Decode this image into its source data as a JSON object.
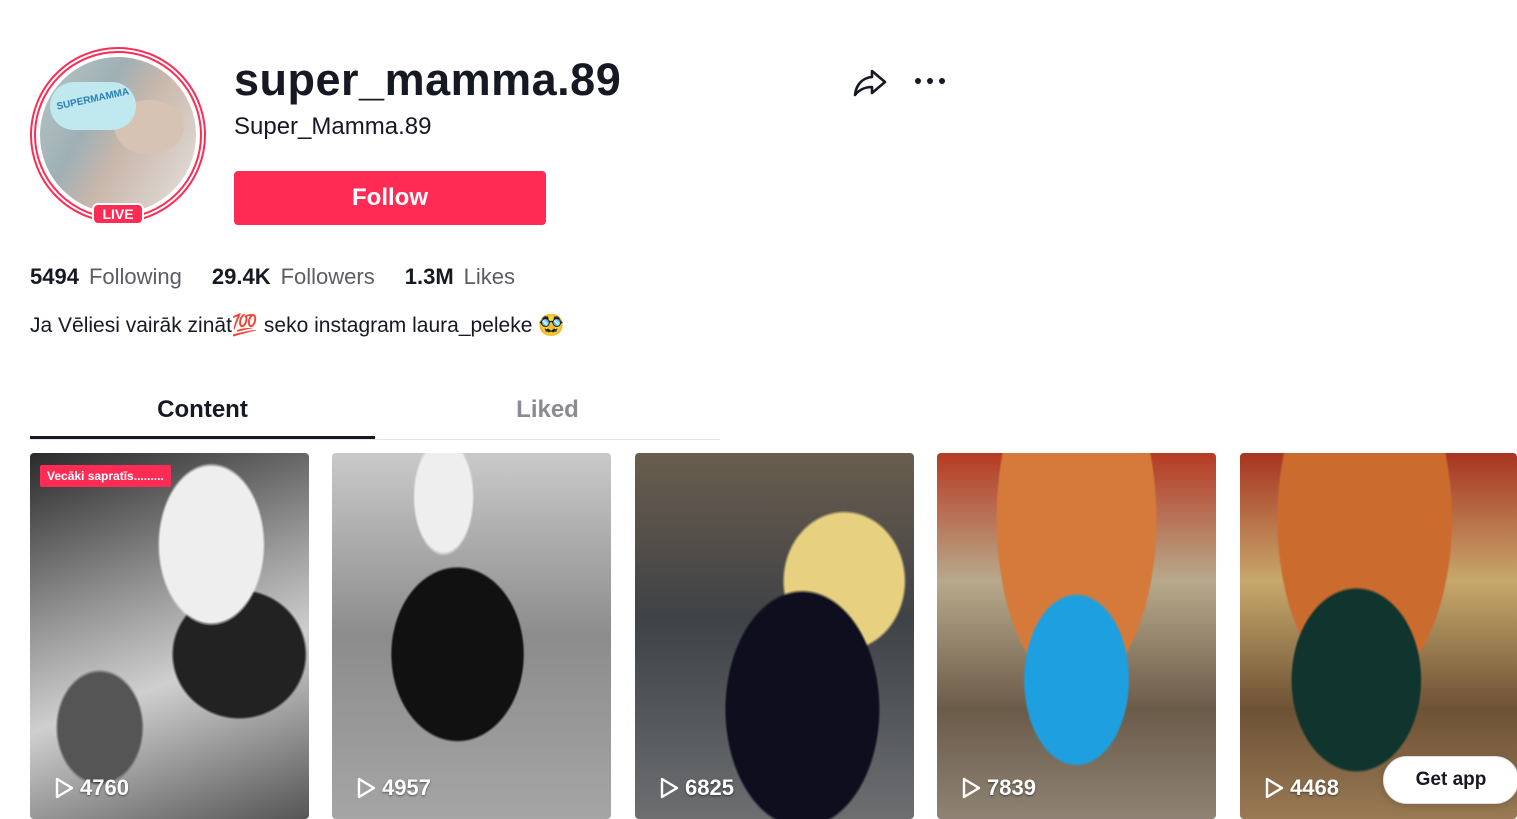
{
  "profile": {
    "username": "super_mamma.89",
    "nickname": "Super_Mamma.89",
    "avatar_text": "SUPERMAMMA",
    "live_badge": "LIVE",
    "follow_label": "Follow",
    "bio": "Ja Vēliesi vairāk zināt💯 seko instagram laura_peleke 🥸"
  },
  "stats": {
    "following": {
      "value": "5494",
      "label": "Following"
    },
    "followers": {
      "value": "29.4K",
      "label": "Followers"
    },
    "likes": {
      "value": "1.3M",
      "label": "Likes"
    }
  },
  "tabs": [
    {
      "label": "Content",
      "active": true
    },
    {
      "label": "Liked",
      "active": false
    }
  ],
  "videos": [
    {
      "views": "4760",
      "overlay_text": "Vecāki sapratīs........."
    },
    {
      "views": "4957"
    },
    {
      "views": "6825"
    },
    {
      "views": "7839"
    },
    {
      "views": "4468"
    }
  ],
  "get_app_label": "Get app",
  "icons": {
    "share": "share-icon",
    "more": "more-icon",
    "play": "play-icon"
  },
  "colors": {
    "accent": "#fe2c55",
    "text": "#161823",
    "secondary_text": "#5c5d63"
  }
}
